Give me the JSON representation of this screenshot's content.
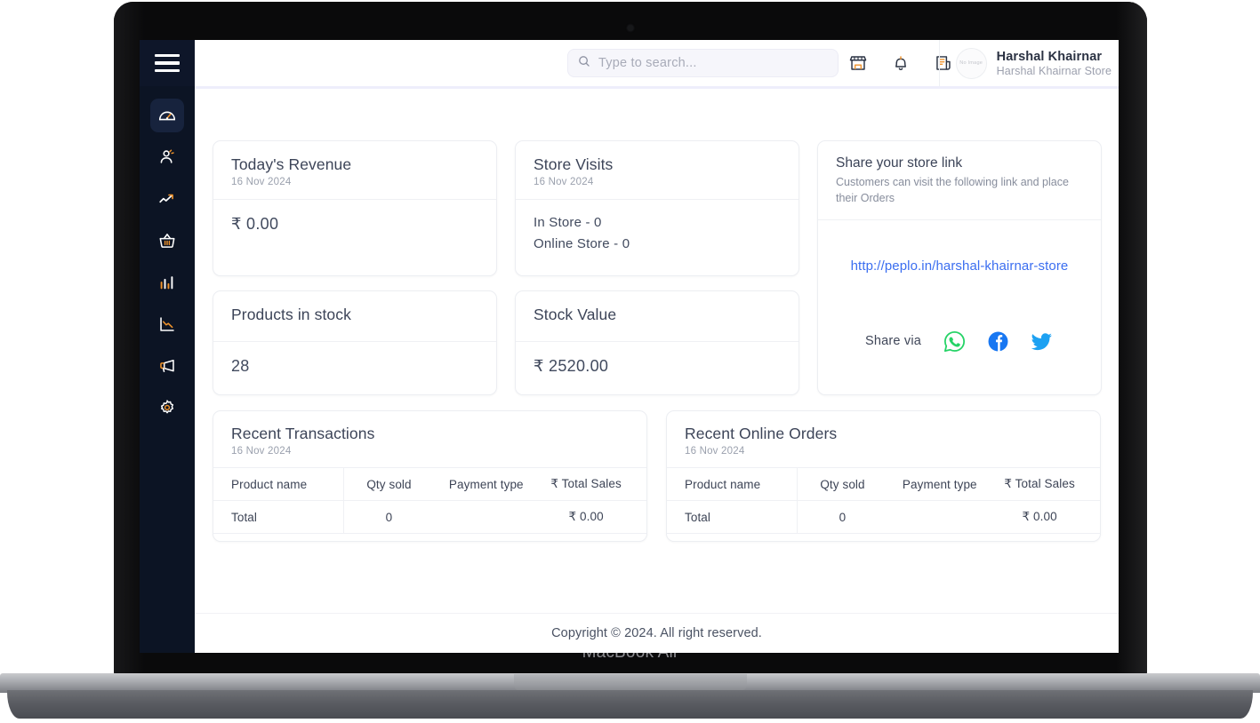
{
  "device": {
    "label": "MacBook Air"
  },
  "sidebar": {
    "menu_icon": "hamburger-menu-icon",
    "items": [
      {
        "name": "dashboard",
        "icon": "speedometer-icon",
        "active": true
      },
      {
        "name": "customers",
        "icon": "user-icon",
        "active": false
      },
      {
        "name": "sales-trends",
        "icon": "trending-up-icon",
        "active": false
      },
      {
        "name": "products",
        "icon": "basket-icon",
        "active": false
      },
      {
        "name": "reports",
        "icon": "bar-chart-icon",
        "active": false
      },
      {
        "name": "analytics",
        "icon": "line-chart-down-icon",
        "active": false
      },
      {
        "name": "marketing",
        "icon": "megaphone-icon",
        "active": false
      },
      {
        "name": "settings",
        "icon": "gear-icon",
        "active": false
      }
    ]
  },
  "header": {
    "search": {
      "placeholder": "Type to search...",
      "value": "",
      "icon": "search-icon"
    },
    "icons": [
      {
        "name": "store-icon"
      },
      {
        "name": "bell-icon"
      },
      {
        "name": "invoice-icon"
      }
    ],
    "profile": {
      "avatar_text": "No Image",
      "name": "Harshal Khairnar",
      "store": "Harshal Khairnar Store"
    }
  },
  "cards": {
    "revenue": {
      "title": "Today's Revenue",
      "date": "16 Nov 2024",
      "value": "₹  0.00"
    },
    "visits": {
      "title": "Store Visits",
      "date": "16 Nov 2024",
      "in_store": "In Store - 0",
      "online_store": "Online Store - 0"
    },
    "products": {
      "title": "Products in stock",
      "value": "28"
    },
    "stock_value": {
      "title": "Stock Value",
      "value": "₹ 2520.00"
    },
    "share": {
      "title": "Share your store link",
      "description": "Customers can visit the following link and place their Orders",
      "link": "http://peplo.in/harshal-khairnar-store",
      "share_label": "Share via",
      "socials": [
        {
          "name": "whatsapp-icon",
          "color": "#25D366"
        },
        {
          "name": "facebook-icon",
          "color": "#1877F2"
        },
        {
          "name": "twitter-icon",
          "color": "#1DA1F2"
        }
      ]
    }
  },
  "tables": {
    "transactions": {
      "title": "Recent Transactions",
      "date": "16 Nov 2024",
      "columns": [
        "Product name",
        "Qty sold",
        "Payment type",
        "₹ Total Sales"
      ],
      "rows": [
        {
          "name": "Total",
          "qty": "0",
          "payment": "",
          "total": "₹ 0.00"
        }
      ]
    },
    "online_orders": {
      "title": "Recent Online Orders",
      "date": "16 Nov 2024",
      "columns": [
        "Product name",
        "Qty sold",
        "Payment type",
        "₹ Total Sales"
      ],
      "rows": [
        {
          "name": "Total",
          "qty": "0",
          "payment": "",
          "total": "₹ 0.00"
        }
      ]
    }
  },
  "footer": {
    "text": "Copyright © 2024. All right reserved."
  },
  "colors": {
    "sidebar_bg": "#0c1424",
    "sidebar_active": "#17233d",
    "icon_stroke": "#ffffff",
    "icon_accent": "#f0932b",
    "link_blue": "#3b6ef0",
    "text_dark": "#3c4458",
    "text_muted": "#9aa0ad"
  }
}
